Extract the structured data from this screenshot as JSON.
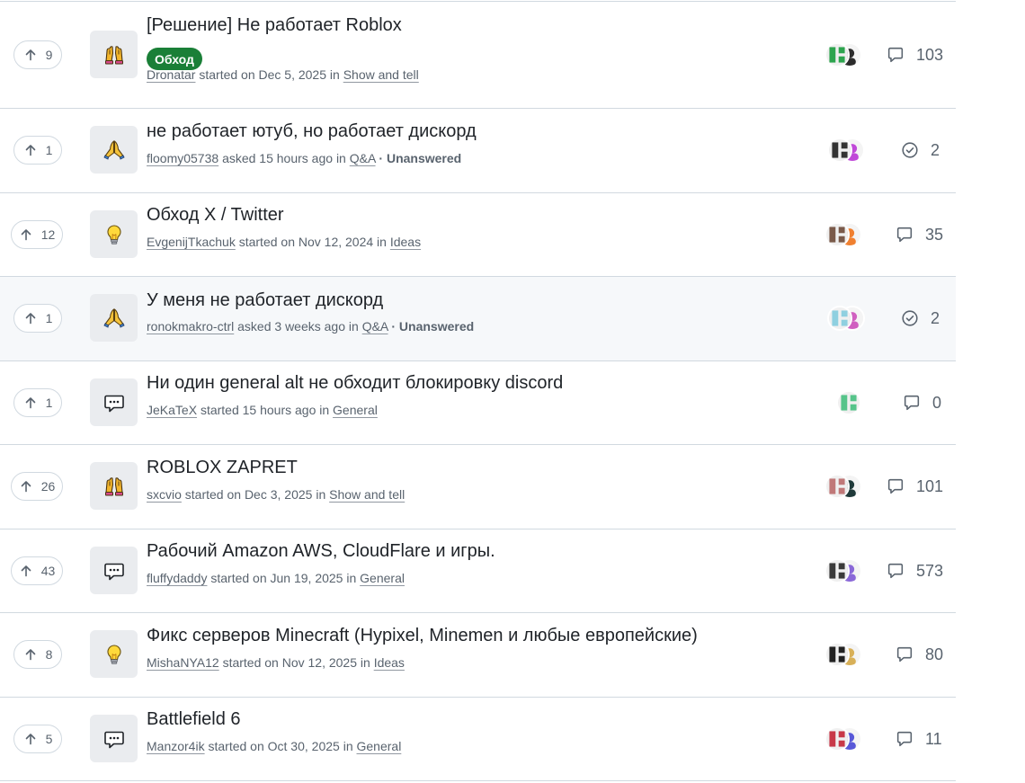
{
  "discussions": [
    {
      "votes": "9",
      "category_icon": "hands-raised-icon",
      "title": "[Решение] Не работает Roblox",
      "label": "Обход",
      "author": "Dronatar",
      "verb": "started on Dec 5, 2025",
      "in_word": "in",
      "category": "Show and tell",
      "status": "",
      "stat_icon": "comment-icon",
      "count": "103",
      "avatar_colors": [
        "#2da44e",
        "#2b2b2b"
      ]
    },
    {
      "votes": "1",
      "category_icon": "pray-icon",
      "title": "не работает ютуб, но работает дискорд",
      "label": "",
      "author": "floomy05738",
      "verb": "asked 15 hours ago",
      "in_word": "in",
      "category": "Q&A",
      "status": "· Unanswered",
      "stat_icon": "check-circle-icon",
      "count": "2",
      "avatar_colors": [
        "#333333",
        "#c048d8"
      ]
    },
    {
      "votes": "12",
      "category_icon": "lightbulb-icon",
      "title": "Обход X / Twitter",
      "label": "",
      "author": "EvgenijTkachuk",
      "verb": "started on Nov 12, 2024",
      "in_word": "in",
      "category": "Ideas",
      "status": "",
      "stat_icon": "comment-icon",
      "count": "35",
      "avatar_colors": [
        "#7a5a4a",
        "#f08030"
      ]
    },
    {
      "votes": "1",
      "category_icon": "pray-icon",
      "title": "У меня не работает дискорд",
      "label": "",
      "author": "ronokmakro-ctrl",
      "verb": "asked 3 weeks ago",
      "in_word": "in",
      "category": "Q&A",
      "status": "· Unanswered",
      "stat_icon": "check-circle-icon",
      "count": "2",
      "avatar_colors": [
        "#8fd0e0",
        "#d060c0"
      ]
    },
    {
      "votes": "1",
      "category_icon": "speech-bubble-icon",
      "title": "Ни один general alt не обходит блокировку discord",
      "label": "",
      "author": "JeKaTeX",
      "verb": "started 15 hours ago",
      "in_word": "in",
      "category": "General",
      "status": "",
      "stat_icon": "comment-icon",
      "count": "0",
      "avatar_colors": [
        "#56c48a"
      ]
    },
    {
      "votes": "26",
      "category_icon": "hands-raised-icon",
      "title": "ROBLOX ZAPRET",
      "label": "",
      "author": "sxcvio",
      "verb": "started on Dec 3, 2025",
      "in_word": "in",
      "category": "Show and tell",
      "status": "",
      "stat_icon": "comment-icon",
      "count": "101",
      "avatar_colors": [
        "#c07878",
        "#1f3a3a"
      ]
    },
    {
      "votes": "43",
      "category_icon": "speech-bubble-icon",
      "title": "Рабочий Amazon AWS, CloudFlare и игры.",
      "label": "",
      "author": "fluffydaddy",
      "verb": "started on Jun 19, 2025",
      "in_word": "in",
      "category": "General",
      "status": "",
      "stat_icon": "comment-icon",
      "count": "573",
      "avatar_colors": [
        "#3a3a3a",
        "#8a68d8"
      ]
    },
    {
      "votes": "8",
      "category_icon": "lightbulb-icon",
      "title": "Фикс серверов Minecraft (Hypixel, Minemen и любые европейские)",
      "label": "",
      "author": "MishaNYA12",
      "verb": "started on Nov 12, 2025",
      "in_word": "in",
      "category": "Ideas",
      "status": "",
      "stat_icon": "comment-icon",
      "count": "80",
      "avatar_colors": [
        "#222222",
        "#d8b058"
      ]
    },
    {
      "votes": "5",
      "category_icon": "speech-bubble-icon",
      "title": "Battlefield 6",
      "label": "",
      "author": "Manzor4ik",
      "verb": "started on Oct 30, 2025",
      "in_word": "in",
      "category": "General",
      "status": "",
      "stat_icon": "comment-icon",
      "count": "11",
      "avatar_colors": [
        "#c83848",
        "#5858d8"
      ]
    }
  ]
}
